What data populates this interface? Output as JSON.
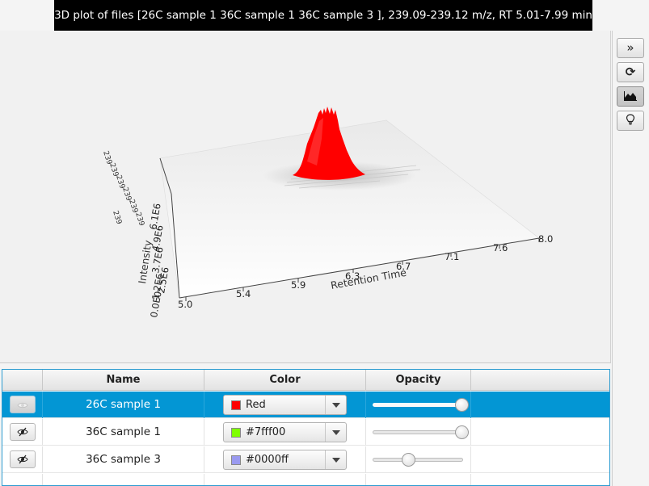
{
  "title": "3D plot of files [26C sample 1 36C sample 1 36C sample 3 ], 239.09-239.12 m/z, RT 5.01-7.99 min",
  "plot": {
    "x_axis_label": "Retention Time",
    "y_axis_label": "Intensity",
    "x_ticks": [
      "5.0",
      "5.4",
      "5.9",
      "6.3",
      "6.7",
      "7.1",
      "7.6",
      "8.0"
    ],
    "y_ticks": [
      "0.0E0",
      "1.2E6",
      "2.5E6",
      "3.7E6",
      "4.9E6",
      "6.1E6"
    ],
    "mz_ticks": [
      "239",
      "239",
      "239",
      "239",
      "239",
      "239",
      "239"
    ],
    "peak_color": "#ff0000"
  },
  "toolbar": {
    "buttons": [
      {
        "icon": "double-chevron-right-icon",
        "glyph": "»"
      },
      {
        "icon": "refresh-icon",
        "glyph": "⟳"
      },
      {
        "icon": "area-chart-icon",
        "glyph": ""
      },
      {
        "icon": "lightbulb-icon",
        "glyph": ""
      }
    ]
  },
  "table": {
    "columns": [
      "",
      "Name",
      "Color",
      "Opacity",
      ""
    ],
    "rows": [
      {
        "name": "26C sample 1",
        "color_label": "Red",
        "color": "#ff0000",
        "opacity": 0.98,
        "selected": true
      },
      {
        "name": "36C sample 1",
        "color_label": "#7fff00",
        "color": "#7fff00",
        "opacity": 0.98,
        "selected": false
      },
      {
        "name": "36C sample 3",
        "color_label": "#0000ff",
        "color": "#9a9af0",
        "opacity": 0.37,
        "selected": false
      }
    ]
  }
}
